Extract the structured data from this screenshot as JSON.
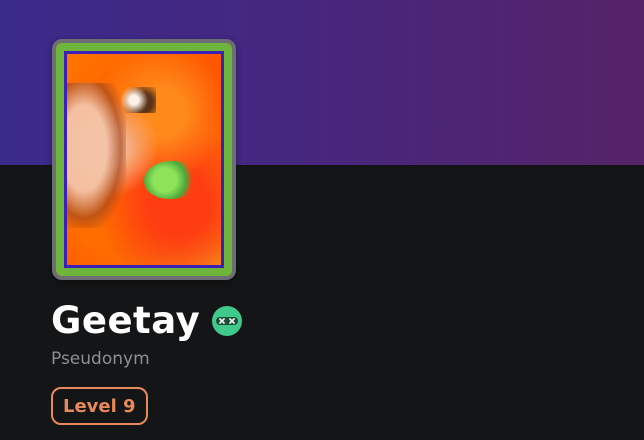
{
  "profile": {
    "display_name": "Geetay",
    "subtitle": "Pseudonym",
    "level_label": "Level 9",
    "avatar_icon": "abstract-portrait-art",
    "badge_icon": "mascot-face-icon"
  },
  "colors": {
    "banner_start": "#3a2a8a",
    "banner_end": "#562368",
    "background": "#141516",
    "level_accent": "#e8895a",
    "mascot_green": "#3fc98b"
  }
}
